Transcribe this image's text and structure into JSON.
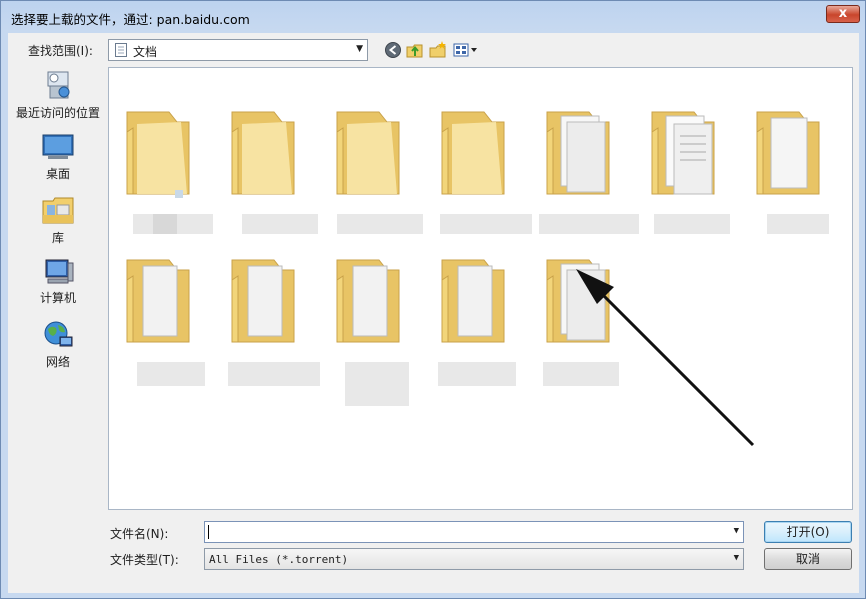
{
  "window": {
    "title": "选择要上载的文件，通过: pan.baidu.com",
    "close_glyph": "x"
  },
  "toolbar": {
    "look_in_label": "查找范围(I):",
    "current_folder": "文档",
    "icons": [
      "back-icon",
      "up-folder-icon",
      "new-folder-icon",
      "view-menu-icon"
    ]
  },
  "places": [
    {
      "label": "最近访问的位置",
      "icon": "recent-places-icon"
    },
    {
      "label": "桌面",
      "icon": "desktop-icon"
    },
    {
      "label": "库",
      "icon": "libraries-icon"
    },
    {
      "label": "计算机",
      "icon": "computer-icon"
    },
    {
      "label": "网络",
      "icon": "network-icon"
    }
  ],
  "files": {
    "folder_count": 12,
    "names_obscured": true
  },
  "form": {
    "filename_label": "文件名(N):",
    "filename_value": "",
    "filetype_label": "文件类型(T):",
    "filetype_value": "All Files (*.torrent)"
  },
  "buttons": {
    "open_label": "打开(O)",
    "cancel_label": "取消"
  },
  "colors": {
    "folder": "#f2d57a",
    "window_frame": "#c7d9f0",
    "close_button": "#c9462c"
  }
}
